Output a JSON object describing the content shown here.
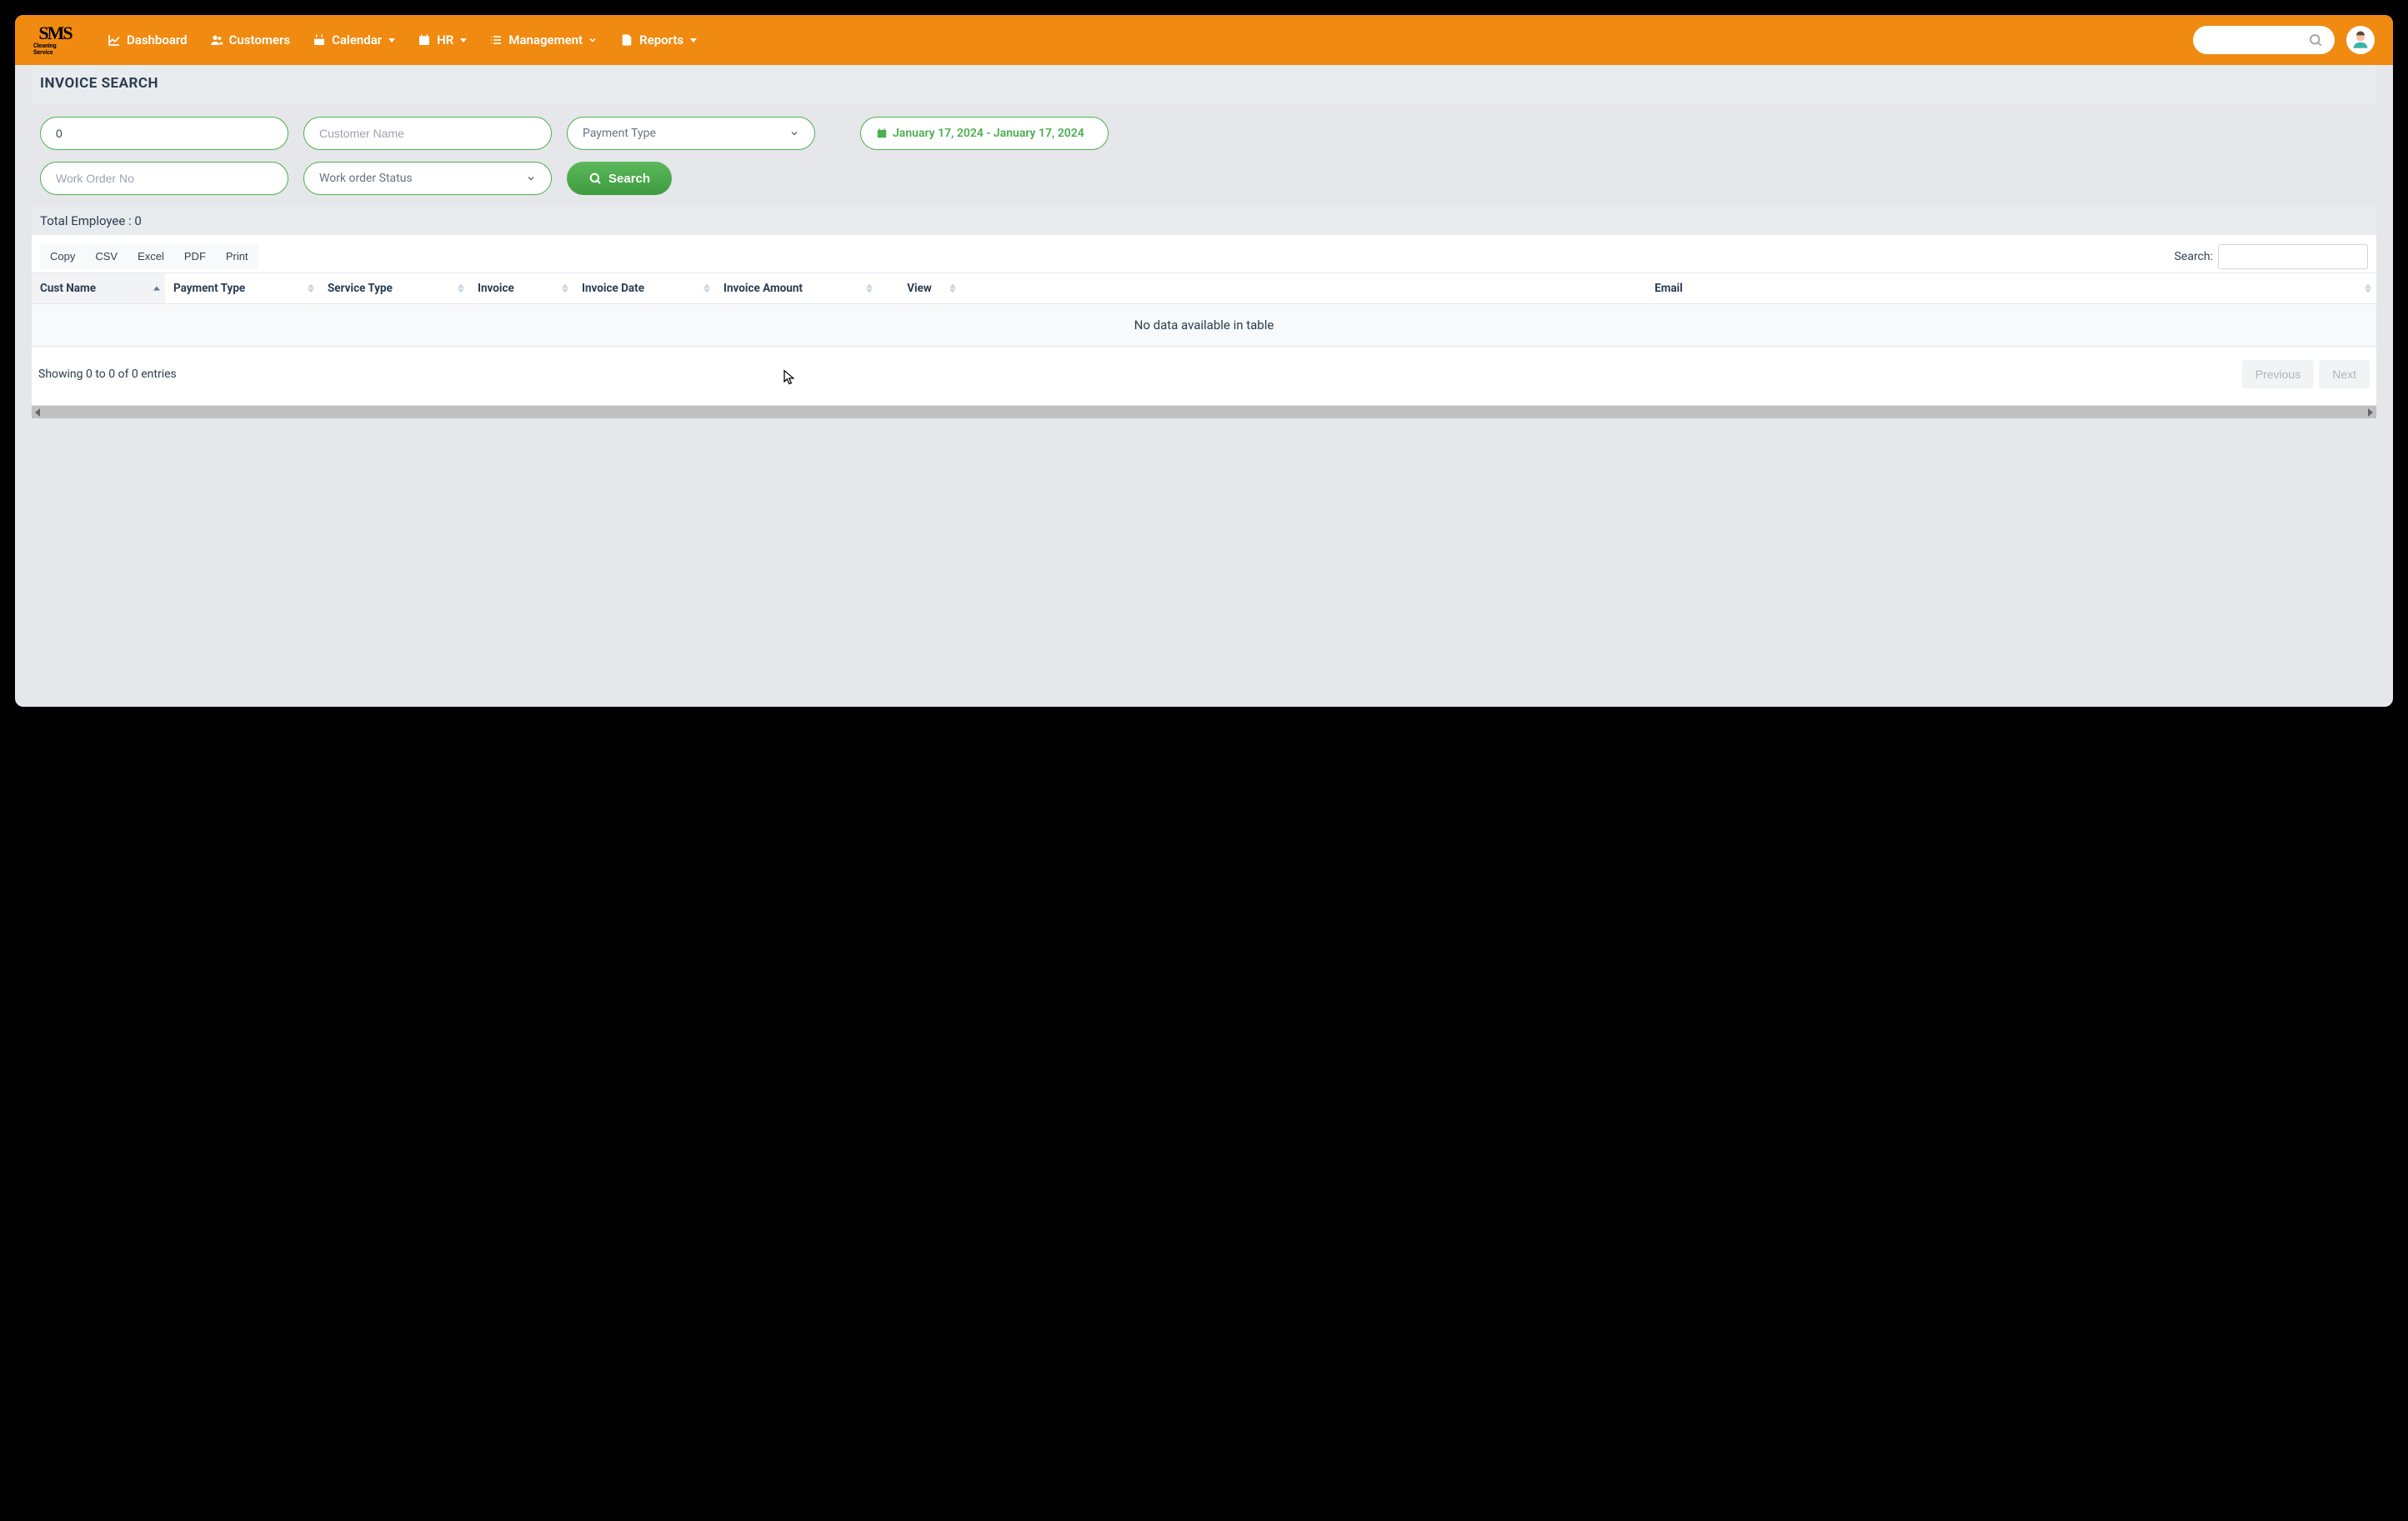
{
  "nav": {
    "logo": "SMS",
    "logoSub": "Cleaning Service",
    "items": [
      "Dashboard",
      "Customers",
      "Calendar",
      "HR",
      "Management",
      "Reports"
    ]
  },
  "page": {
    "title": "INVOICE SEARCH"
  },
  "filters": {
    "invoiceValue": "0",
    "customerNamePlaceholder": "Customer Name",
    "paymentTypeLabel": "Payment Type",
    "workOrderNoPlaceholder": "Work Order No",
    "workOrderStatusLabel": "Work order Status",
    "dateRange": "January 17, 2024 - January 17, 2024",
    "searchLabel": "Search"
  },
  "totalBar": "Total Employee : 0",
  "export": {
    "copy": "Copy",
    "csv": "CSV",
    "excel": "Excel",
    "pdf": "PDF",
    "print": "Print"
  },
  "tableSearchLabel": "Search:",
  "columns": [
    "Cust Name",
    "Payment Type",
    "Service Type",
    "Invoice",
    "Invoice Date",
    "Invoice Amount",
    "View",
    "Email"
  ],
  "noData": "No data available in table",
  "showing": "Showing 0 to 0 of 0 entries",
  "pagination": {
    "prev": "Previous",
    "next": "Next"
  }
}
